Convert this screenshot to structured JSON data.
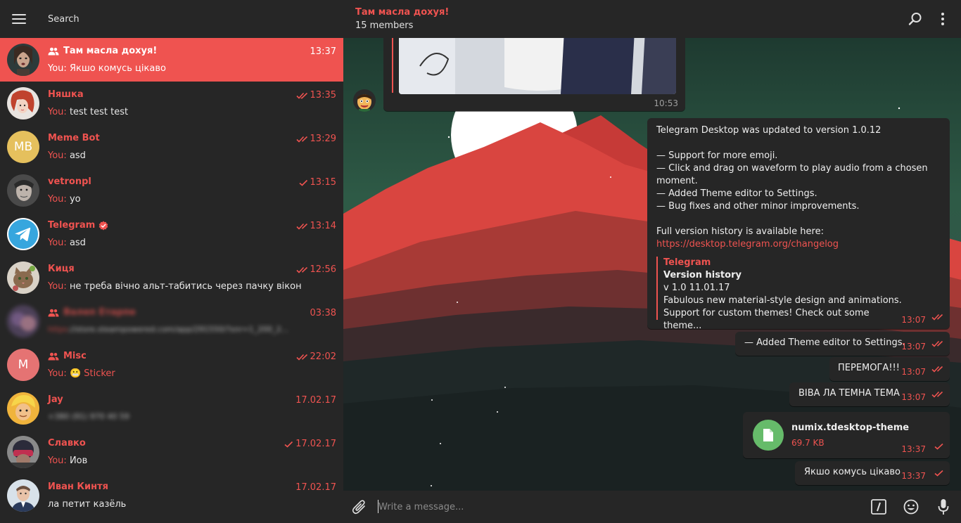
{
  "sidebar": {
    "search_placeholder": "Search",
    "dialogs": [
      {
        "name": "Там масла дохуя!",
        "time": "13:37",
        "prefix": "You:",
        "message": "Якшо комусь цікаво",
        "group": true,
        "check": "none",
        "active": true
      },
      {
        "name": "Няшка",
        "time": "13:35",
        "prefix": "You:",
        "message": "test test test",
        "check": "double"
      },
      {
        "name": "Meme Bot",
        "time": "13:29",
        "prefix": "You:",
        "message": "asd",
        "check": "double",
        "initials": "MB"
      },
      {
        "name": "vetronpl",
        "time": "13:15",
        "prefix": "You:",
        "message": "yo",
        "check": "single"
      },
      {
        "name": "Telegram",
        "time": "13:14",
        "prefix": "You:",
        "message": "asd",
        "check": "double",
        "verified": true
      },
      {
        "name": "Киця",
        "time": "12:56",
        "prefix": "You:",
        "message": "не треба вічно альт-табитись через пачку вікон",
        "check": "double"
      },
      {
        "name": "Валеп Етарпе",
        "time": "03:38",
        "prefix": "https",
        "message": "://store.steampowered.com/app/291550/?snr=1_200_2...",
        "group": true,
        "check": "none",
        "blurred": true
      },
      {
        "name": "Misc",
        "time": "22:02",
        "prefix": "You:",
        "message": "😬 Sticker",
        "group": true,
        "check": "double",
        "initials": "M"
      },
      {
        "name": "Jay",
        "time": "17.02.17",
        "prefix": "",
        "message": "+380 (91) 970 40 59",
        "check": "none",
        "blurred_msg": true
      },
      {
        "name": "Славко",
        "time": "17.02.17",
        "prefix": "You:",
        "message": "Йов",
        "check": "single"
      },
      {
        "name": "Иван Кинтя",
        "time": "17.02.17",
        "prefix": "",
        "message": "ла петит казёль",
        "check": "none"
      }
    ]
  },
  "chat": {
    "title": "Там масла дохуя!",
    "members": "15 members",
    "photo_time": "10:53",
    "update_message": {
      "line1": "Telegram Desktop was updated to version 1.0.12",
      "bullets": [
        "— Support for more emoji.",
        "— Click and drag on waveform to play audio from a chosen",
        "moment.",
        "— Added Theme editor to Settings.",
        "— Bug fixes and other minor improvements."
      ],
      "history_line": "Full version history is available here:",
      "link": "https://desktop.telegram.org/changelog",
      "preview_site": "Telegram",
      "preview_title": "Version history",
      "preview_line1": "v 1.0 11.01.17",
      "preview_line2": "Fabulous new material-style design and animations.",
      "preview_line3": "Support for custom themes! Check out some theme...",
      "time": "13:07"
    },
    "messages": [
      {
        "text": "— Added Theme editor to Settings.",
        "time": "13:07"
      },
      {
        "text": "ПЕРЕМОГА!!!",
        "time": "13:07"
      },
      {
        "text": "ВІВА ЛА ТЕМНА ТЕМА",
        "time": "13:07"
      }
    ],
    "file": {
      "name": "numix.tdesktop-theme",
      "size": "69.7 KB",
      "time": "13:37"
    },
    "last_message": {
      "text": "Якшо комусь цікаво",
      "time": "13:37"
    },
    "compose_placeholder": "Write a message..."
  },
  "colors": {
    "accent": "#ef5350",
    "sidebar_bg": "#262626",
    "bubble_bg": "#262626",
    "file_icon_bg": "#66bb6a"
  }
}
